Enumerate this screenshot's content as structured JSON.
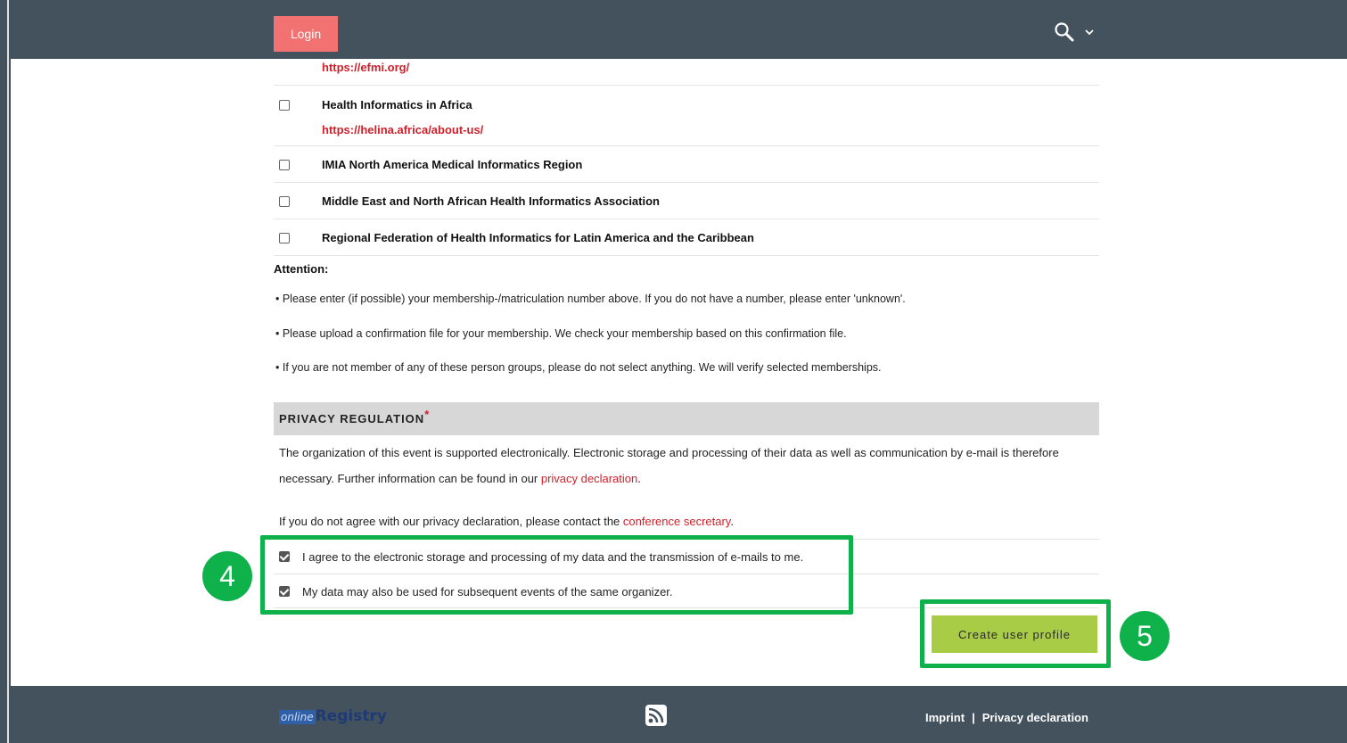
{
  "header": {
    "login_label": "Login",
    "search_icon": "search-icon",
    "dropdown_icon": "chevron-down-icon"
  },
  "memberships": {
    "top_link": "https://efmi.org/",
    "items": [
      {
        "name": "Health Informatics in Africa",
        "link": "https://helina.africa/about-us/",
        "checked": false
      },
      {
        "name": "IMIA North America Medical Informatics Region",
        "checked": false
      },
      {
        "name": "Middle East and North African Health Informatics Association",
        "checked": false
      },
      {
        "name": "Regional Federation of Health Informatics for Latin America and the Caribbean",
        "checked": false
      }
    ]
  },
  "attention": {
    "title": "Attention:",
    "bullets": [
      "• Please enter (if possible) your membership-/matriculation number above. If you do not have a number, please enter 'unknown'.",
      "• Please upload a confirmation file for your membership. We check your membership based on this confirmation file.",
      "• If you are not member of any of these person groups, please do not select anything. We will verify selected memberships."
    ]
  },
  "privacy": {
    "heading": "PRIVACY REGULATION",
    "required_mark": "*",
    "para1_a": "The organization of this event is supported electronically. Electronic storage and processing of their data as well as communication by e-mail is therefore necessary. Further information can be found in our ",
    "para1_link": "privacy declaration",
    "para1_b": ".",
    "para2_a": "If you do not agree with our privacy declaration, please contact the ",
    "para2_link": "conference secretary",
    "para2_b": ".",
    "agree1": "I agree to the electronic storage and processing of my data and the transmission of e-mails to me.",
    "agree2": "My data may also be used for subsequent events of the same organizer.",
    "agree1_checked": true,
    "agree2_checked": true
  },
  "annotations": {
    "step4": "4",
    "step5": "5",
    "highlight_color": "#0fb14b"
  },
  "create_button": "Create user profile",
  "footer": {
    "logo_prefix": "online",
    "logo_main": "Registry",
    "rss_icon": "rss-icon",
    "imprint": "Imprint",
    "separator": "|",
    "privacy": "Privacy declaration"
  },
  "colors": {
    "topbar": "#44525e",
    "login": "#f27171",
    "link": "#d0202a",
    "create_button": "#a8cc45"
  }
}
